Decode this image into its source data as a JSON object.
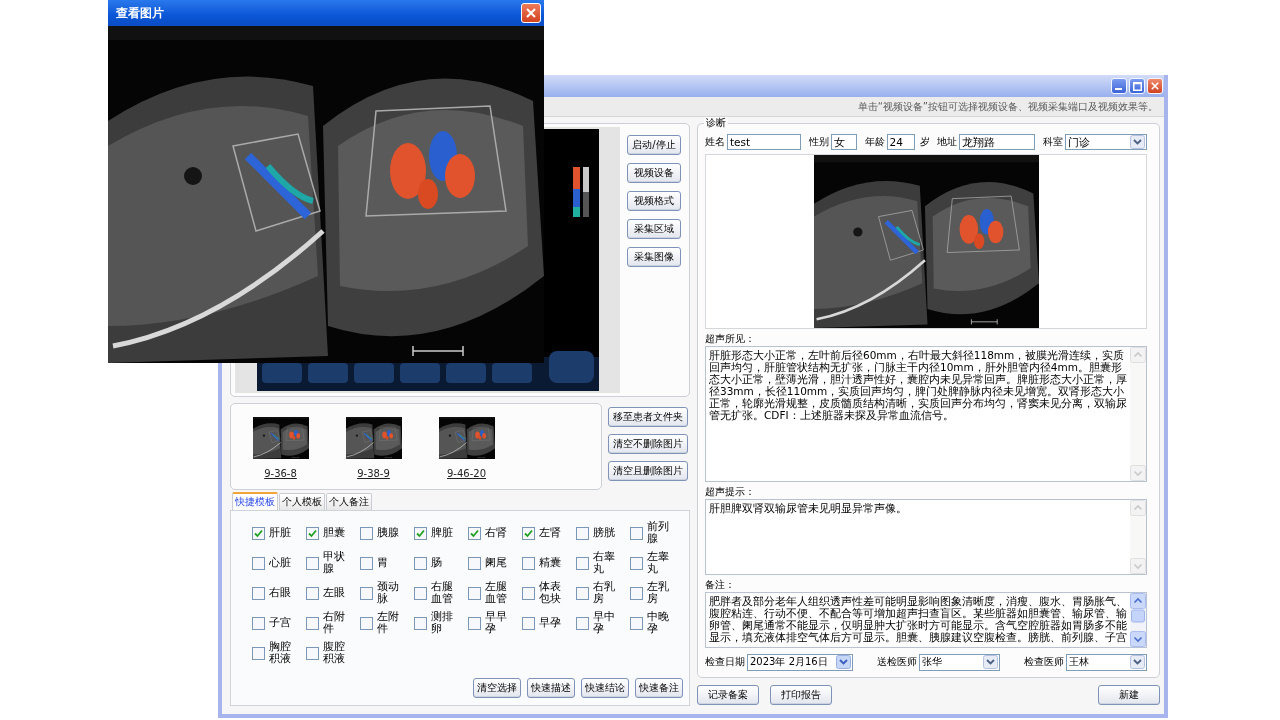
{
  "image_viewer": {
    "title": "查看图片"
  },
  "main_window": {
    "hint": "单击“视频设备”按钮可选择视频设备、视频采集端口及视频效果等。"
  },
  "capture_buttons": [
    "启动/停止",
    "视频设备",
    "视频格式",
    "采集区域",
    "采集图像"
  ],
  "thumbnails": [
    {
      "label": "9-36-8"
    },
    {
      "label": "9-38-9"
    },
    {
      "label": "9-46-20"
    }
  ],
  "image_buttons": [
    "移至患者文件夹",
    "清空不删除图片",
    "清空且删除图片"
  ],
  "template_tabs": [
    {
      "label": "快捷模板",
      "selected": true
    },
    {
      "label": "个人模板",
      "selected": false
    },
    {
      "label": "个人备注",
      "selected": false
    }
  ],
  "organs": [
    {
      "label": "肝脏",
      "checked": true
    },
    {
      "label": "胆囊",
      "checked": true
    },
    {
      "label": "胰腺",
      "checked": false
    },
    {
      "label": "脾脏",
      "checked": true
    },
    {
      "label": "右肾",
      "checked": true
    },
    {
      "label": "左肾",
      "checked": true
    },
    {
      "label": "膀胱",
      "checked": false
    },
    {
      "label": "前列腺",
      "checked": false
    },
    {
      "label": "心脏",
      "checked": false
    },
    {
      "label": "甲状腺",
      "checked": false
    },
    {
      "label": "胃",
      "checked": false
    },
    {
      "label": "肠",
      "checked": false
    },
    {
      "label": "阑尾",
      "checked": false
    },
    {
      "label": "精囊",
      "checked": false
    },
    {
      "label": "右睾丸",
      "checked": false
    },
    {
      "label": "左睾丸",
      "checked": false
    },
    {
      "label": "右眼",
      "checked": false
    },
    {
      "label": "左眼",
      "checked": false
    },
    {
      "label": "颈动脉",
      "checked": false
    },
    {
      "label": "右腿血管",
      "checked": false
    },
    {
      "label": "左腿血管",
      "checked": false
    },
    {
      "label": "体表包块",
      "checked": false
    },
    {
      "label": "右乳房",
      "checked": false
    },
    {
      "label": "左乳房",
      "checked": false
    },
    {
      "label": "子宫",
      "checked": false
    },
    {
      "label": "右附件",
      "checked": false
    },
    {
      "label": "左附件",
      "checked": false
    },
    {
      "label": "测排卵",
      "checked": false
    },
    {
      "label": "早早孕",
      "checked": false
    },
    {
      "label": "早孕",
      "checked": false
    },
    {
      "label": "早中孕",
      "checked": false
    },
    {
      "label": "中晚孕",
      "checked": false
    },
    {
      "label": "胸腔积液",
      "checked": false
    },
    {
      "label": "腹腔积液",
      "checked": false
    }
  ],
  "template_buttons": [
    "清空选择",
    "快速描述",
    "快速结论",
    "快速备注"
  ],
  "diagnosis": {
    "title": "诊断",
    "fields": [
      {
        "label": "姓名",
        "value": "test",
        "kind": "text"
      },
      {
        "label": "性别",
        "value": "女",
        "kind": "text"
      },
      {
        "label": "年龄",
        "value": "24",
        "unit": "岁",
        "kind": "text"
      },
      {
        "label": "地址",
        "value": "龙翔路",
        "kind": "text"
      },
      {
        "label": "科室",
        "value": "门诊",
        "kind": "dropdown"
      }
    ],
    "sections": [
      {
        "label": "超声所见：",
        "text": "肝脏形态大小正常，左叶前后径60mm，右叶最大斜径118mm，被膜光滑连续，实质回声均匀，肝脏管状结构无扩张，门脉主干内径10mm，肝外胆管内径4mm。胆囊形态大小正常，壁薄光滑，胆汁透声性好，囊腔内未见异常回声。脾脏形态大小正常，厚径33mm，长径110mm，实质回声均匀，脾门处脾静脉内径未见增宽。双肾形态大小正常，轮廓光滑规整，皮质髓质结构清晰，实质回声分布均匀，肾窦未见分离，双输尿管无扩张。CDFI：上述脏器未探及异常血流信号。",
        "scrollable": false
      },
      {
        "label": "超声提示：",
        "text": "肝胆脾双肾双输尿管未见明显异常声像。",
        "scrollable": false
      },
      {
        "label": "备注：",
        "text": "肥胖者及部分老年人组织透声性差可能明显影响图象清晰度，消瘦、腹水、胃肠胀气、腹腔粘连、行动不便、不配合等可增加超声扫查盲区。某些脏器如胆囊管、输尿管、输卵管、阑尾通常不能显示，仅明显肿大扩张时方可能显示。含气空腔脏器如胃肠多不能显示，填充液体排空气体后方可显示。胆囊、胰腺建议空腹检查。膀胱、前列腺、子宫",
        "scrollable": true
      }
    ],
    "exam_fields": [
      {
        "label": "检查日期",
        "value": "2023年 2月16日",
        "kind": "date"
      },
      {
        "label": "送检医师",
        "value": "张华",
        "kind": "dropdown"
      },
      {
        "label": "检查医师",
        "value": "王林",
        "kind": "dropdown"
      }
    ]
  },
  "report_buttons": [
    "记录备案",
    "打印报告"
  ],
  "new_button": "新建"
}
